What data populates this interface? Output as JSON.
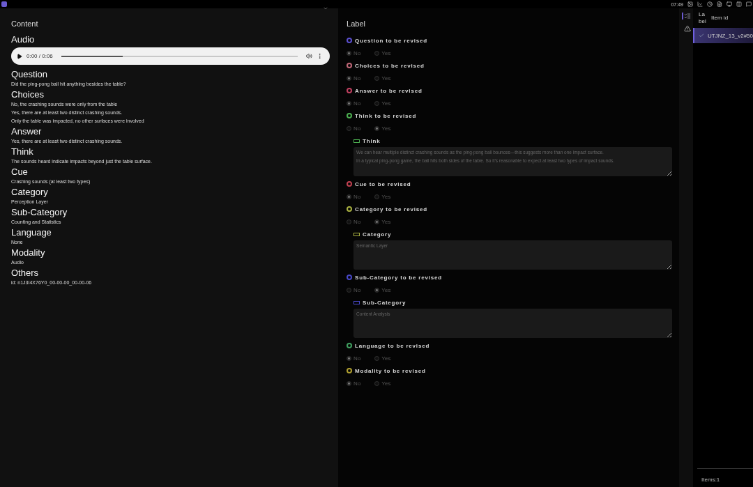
{
  "top_bar": {
    "time": "07:49"
  },
  "content": {
    "title": "Content",
    "audio": {
      "heading": "Audio",
      "time": "0:00 / 0:06",
      "level": 0.26
    },
    "sections": [
      {
        "heading": "Question",
        "lines": [
          "Did the ping-pong ball hit anything besides the table?"
        ]
      },
      {
        "heading": "Choices",
        "lines": [
          "No, the crashing sounds were only from the table",
          "Yes, there are at least two distinct crashing sounds.",
          "Only the table was impacted, no other surfaces were involved"
        ]
      },
      {
        "heading": "Answer",
        "lines": [
          "Yes, there are at least two distinct crashing sounds."
        ]
      },
      {
        "heading": "Think",
        "lines": [
          "The sounds heard indicate impacts beyond just the table surface."
        ]
      },
      {
        "heading": "Cue",
        "lines": [
          "Crashing sounds (at least two types)"
        ]
      },
      {
        "heading": "Category",
        "lines": [
          "Perception Layer"
        ]
      },
      {
        "heading": "Sub-Category",
        "lines": [
          "Counting and Statistics"
        ]
      },
      {
        "heading": "Language",
        "lines": [
          "None"
        ]
      },
      {
        "heading": "Modality",
        "lines": [
          "Audio"
        ]
      },
      {
        "heading": "Others",
        "lines": [
          "id: n1J3I4X76Y0_00-00-00_00-00-06"
        ]
      }
    ]
  },
  "label": {
    "title": "Label",
    "groups": [
      {
        "title": "Question to be revised",
        "color": "#5b4fd0",
        "options": [
          {
            "label": "No",
            "selected": true
          },
          {
            "label": "Yes",
            "selected": false
          }
        ]
      },
      {
        "title": "Choices to be revised",
        "color": "#c06878",
        "options": [
          {
            "label": "No",
            "selected": true
          },
          {
            "label": "Yes",
            "selected": false
          }
        ]
      },
      {
        "title": "Answer to be revised",
        "color": "#c04060",
        "options": [
          {
            "label": "No",
            "selected": true
          },
          {
            "label": "Yes",
            "selected": false
          }
        ]
      },
      {
        "title": "Think to be revised",
        "color": "#4caf50",
        "options": [
          {
            "label": "No",
            "selected": false
          },
          {
            "label": "Yes",
            "selected": true
          }
        ],
        "field": {
          "label": "Think",
          "value": "We can hear multiple distinct crashing sounds as the ping-pong ball bounces—this suggests more than one impact surface.\nIn a typical ping-pong game, the ball hits both sides of the table. So it’s reasonable to expect at least two types of impact sounds."
        }
      },
      {
        "title": "Cue to be revised",
        "color": "#c04050",
        "options": [
          {
            "label": "No",
            "selected": true
          },
          {
            "label": "Yes",
            "selected": false
          }
        ]
      },
      {
        "title": "Category to be revised",
        "color": "#a8b040",
        "options": [
          {
            "label": "No",
            "selected": false
          },
          {
            "label": "Yes",
            "selected": true
          }
        ],
        "field": {
          "label": "Category",
          "value": "Semantic Layer"
        }
      },
      {
        "title": "Sub-Category to be revised",
        "color": "#4848c8",
        "options": [
          {
            "label": "No",
            "selected": false
          },
          {
            "label": "Yes",
            "selected": true
          }
        ],
        "field": {
          "label": "Sub-Category",
          "value": "Content Analysis"
        }
      },
      {
        "title": "Language to be revised",
        "color": "#40a060",
        "options": [
          {
            "label": "No",
            "selected": true
          },
          {
            "label": "Yes",
            "selected": false
          }
        ]
      },
      {
        "title": "Modality to be revised",
        "color": "#b0a030",
        "options": [
          {
            "label": "No",
            "selected": true
          },
          {
            "label": "Yes",
            "selected": false
          }
        ]
      }
    ]
  },
  "side_tabs": [
    {
      "kind": "list",
      "selected": true
    },
    {
      "kind": "warning",
      "selected": false
    }
  ],
  "items": {
    "columns": [
      "La bel",
      "Item id"
    ],
    "rows": [
      {
        "id": "UTJNZ_13_v2#50",
        "checked": true,
        "selected": true
      }
    ],
    "footer": "Items:1"
  }
}
